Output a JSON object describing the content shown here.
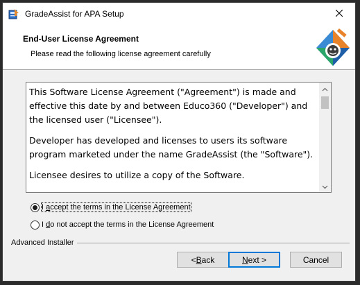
{
  "window": {
    "title": "GradeAssist for APA Setup",
    "icons": {
      "app": "installer-icon",
      "close": "close-icon"
    }
  },
  "header": {
    "title": "End-User License Agreement",
    "subtitle": "Please read the following license agreement carefully",
    "logo_icon": "installer-logo-icon"
  },
  "license": {
    "paragraphs": [
      "This Software License Agreement (\"Agreement\") is made and effective this date by and between Educo360 (\"Developer\") and the licensed user (\"Licensee\").",
      "Developer has developed and licenses to users its software program marketed under the name GradeAssist (the \"Software\").",
      "Licensee desires to utilize a copy of the Software."
    ]
  },
  "options": {
    "accept": {
      "pre": "I ",
      "accel": "a",
      "post": "ccept the terms in the License Agreement",
      "selected": true
    },
    "decline": {
      "pre": "I ",
      "accel": "d",
      "post": "o not accept the terms in the License Agreement",
      "selected": false
    }
  },
  "footer": {
    "brand": "Advanced Installer",
    "back": {
      "pre": "< ",
      "accel": "B",
      "post": "ack"
    },
    "next": {
      "pre": "",
      "accel": "N",
      "post": "ext >"
    },
    "cancel": "Cancel"
  },
  "colors": {
    "window_bg": "#f0f0f0",
    "default_button_border": "#0078d7"
  }
}
